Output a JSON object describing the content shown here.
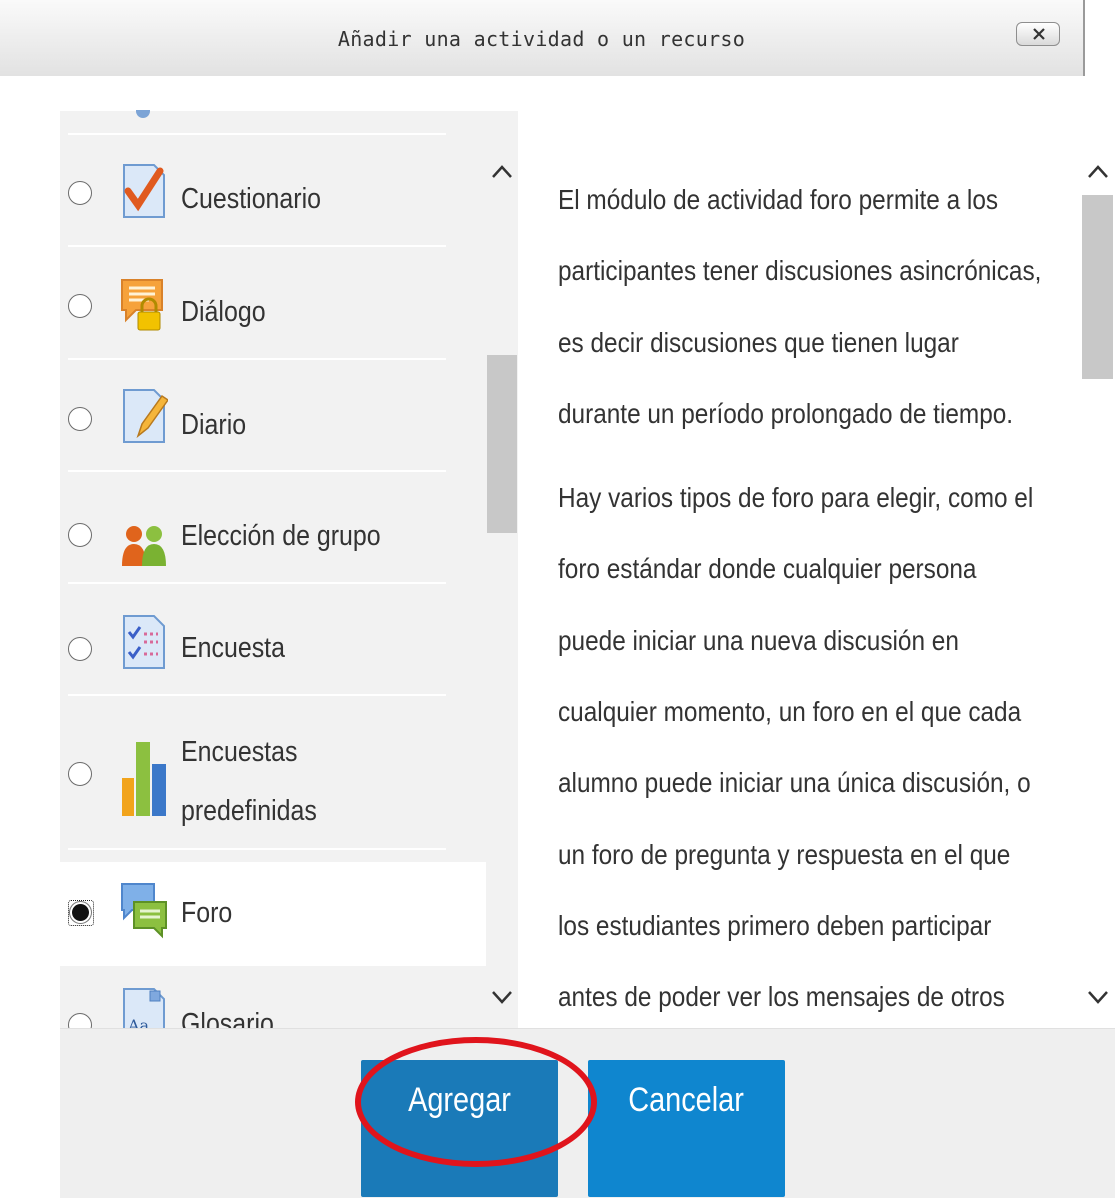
{
  "dialog": {
    "title": "Añadir una actividad o un recurso",
    "close_icon": "close-icon"
  },
  "activities": [
    {
      "label": "Cuestionario",
      "icon": "quiz-icon",
      "selected": false
    },
    {
      "label": "Diálogo",
      "icon": "dialogue-icon",
      "selected": false
    },
    {
      "label": "Diario",
      "icon": "journal-icon",
      "selected": false
    },
    {
      "label": "Elección de grupo",
      "icon": "group-choice-icon",
      "selected": false
    },
    {
      "label": "Encuesta",
      "icon": "survey-icon",
      "selected": false
    },
    {
      "label_line1": "Encuestas",
      "label_line2": "predefinidas",
      "icon": "predefined-surveys-icon",
      "selected": false
    },
    {
      "label": "Foro",
      "icon": "forum-icon",
      "selected": true
    },
    {
      "label": "Glosario",
      "icon": "glossary-icon",
      "selected": false
    }
  ],
  "description": {
    "p1": "El módulo de actividad foro permite a los participantes tener discusiones asincrónicas, es decir discusiones que tienen lugar durante un período prolongado de tiempo.",
    "p2": "Hay varios tipos de foro para elegir, como el foro estándar donde cualquier persona puede iniciar una nueva discusión en cualquier momento, un foro en el que cada alumno puede iniciar una única discusión, o un foro de pregunta y respuesta en el que los estudiantes primero deben participar antes de poder ver los mensajes de otros"
  },
  "buttons": {
    "add_label": "Agregar",
    "cancel_label": "Cancelar"
  },
  "colors": {
    "button_blue": "#0f86cf",
    "highlight_ellipse": "#e0141c"
  }
}
